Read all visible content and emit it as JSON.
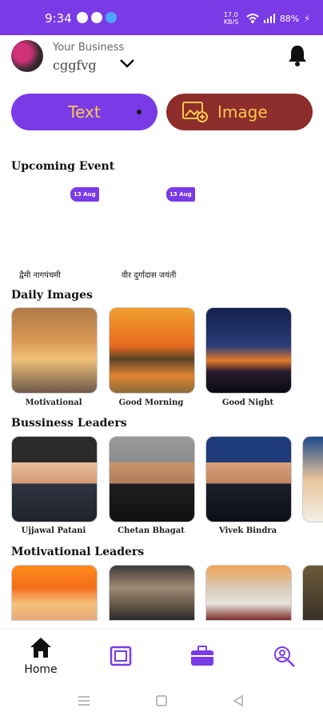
{
  "status": {
    "time": "9:34",
    "battery": "88%",
    "speed": "17.0 KB/S"
  },
  "header": {
    "business_label": "Your Business",
    "business_name": "cggfvg"
  },
  "tabs": {
    "text_label": "Text",
    "image_label": "Image"
  },
  "sections": {
    "upcoming": "Upcoming Event",
    "daily": "Daily Images",
    "business": "Bussiness Leaders",
    "motivational": "Motivational Leaders"
  },
  "events": [
    {
      "date": "13 Aug",
      "name": "द्वैमी नागपंचमी"
    },
    {
      "date": "13 Aug",
      "name": "वीर दुर्गादास जयंती"
    }
  ],
  "daily_images": [
    {
      "label": "Motivational"
    },
    {
      "label": "Good Morning"
    },
    {
      "label": "Good Night"
    }
  ],
  "business_leaders": [
    {
      "label": "Ujjawal Patani"
    },
    {
      "label": "Chetan Bhagat"
    },
    {
      "label": "Vivek Bindra"
    }
  ],
  "bottom_nav": {
    "home_label": "Home"
  },
  "colors": {
    "accent": "#7a3be6",
    "image_tab": "#8d2d2c",
    "tab_text": "#ffc94d"
  }
}
